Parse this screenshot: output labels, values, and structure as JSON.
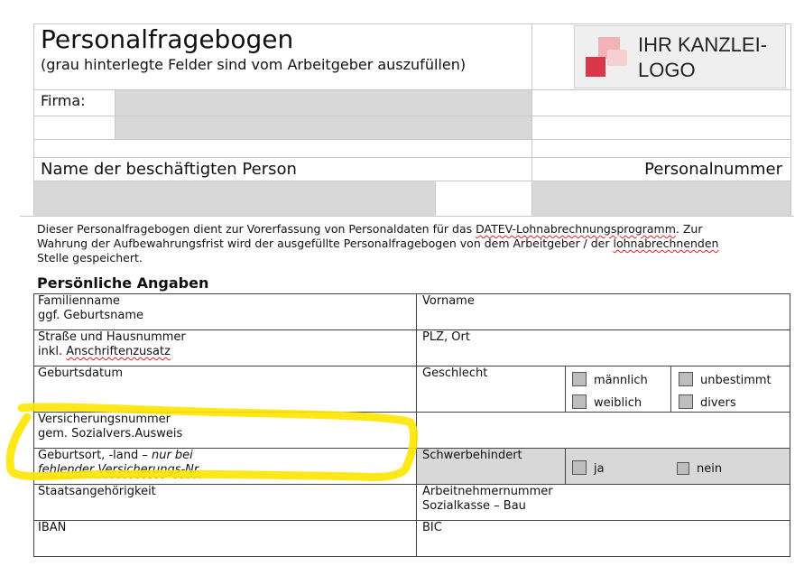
{
  "header": {
    "title": "Personalfragebogen",
    "subtitle": "(grau hinterlegte Felder sind vom Arbeitgeber auszufüllen)",
    "logo_line1": "IHR KANZLEI-",
    "logo_line2": "LOGO",
    "firma_label": "Firma:",
    "name_label": "Name der beschäftigten Person",
    "personalnummer_label": "Personalnummer"
  },
  "intro": {
    "line1_a": "Dieser Personalfragebogen dient zur Vorerfassung von Personaldaten für das ",
    "line1_b": "DATEV-Lohnabrechnungsprogramm",
    "line1_c": ". Zur",
    "line2_a": "Wahrung der Aufbewahrungsfrist wird der ausgefüllte Personalfragebogen von dem Arbeitgeber / der ",
    "line2_b": "lohnabrechnenden",
    "line3": "Stelle gespeichert."
  },
  "section": {
    "title": "Persönliche Angaben"
  },
  "fields": {
    "familienname": "Familienname",
    "geburtsname": "ggf. Geburtsname",
    "vorname": "Vorname",
    "strasse": "Straße und Hausnummer",
    "anschrift_a": "inkl. ",
    "anschrift_b": "Anschriftenzusatz",
    "plz": "PLZ, Ort",
    "geburtsdatum": "Geburtsdatum",
    "geschlecht": "Geschlecht",
    "maennlich": "männlich",
    "unbestimmt": "unbestimmt",
    "weiblich": "weiblich",
    "divers": "divers",
    "versicherungsnummer": "Versicherungsnummer",
    "sozialvers": "gem. Sozialvers.Ausweis",
    "geburtsort": "Geburtsort, -land – ",
    "nur_bei": "nur bei",
    "fehlender_a": " fehlender ",
    "fehlender_b": "Versicherungs-Nr.",
    "schwerbehindert": "Schwerbehindert",
    "ja": "ja",
    "nein": "nein",
    "staatsangehoerigkeit": "Staatsangehörigkeit",
    "arbeitnehmernummer": "Arbeitnehmernummer",
    "sozialkasse": "Sozialkasse – Bau",
    "iban": "IBAN",
    "bic": "BIC"
  },
  "colors": {
    "highlight": "#ffe600",
    "gray_field": "#d8d8d8",
    "logo_red": "#d9374a",
    "logo_pink": "#f1b3b5"
  }
}
